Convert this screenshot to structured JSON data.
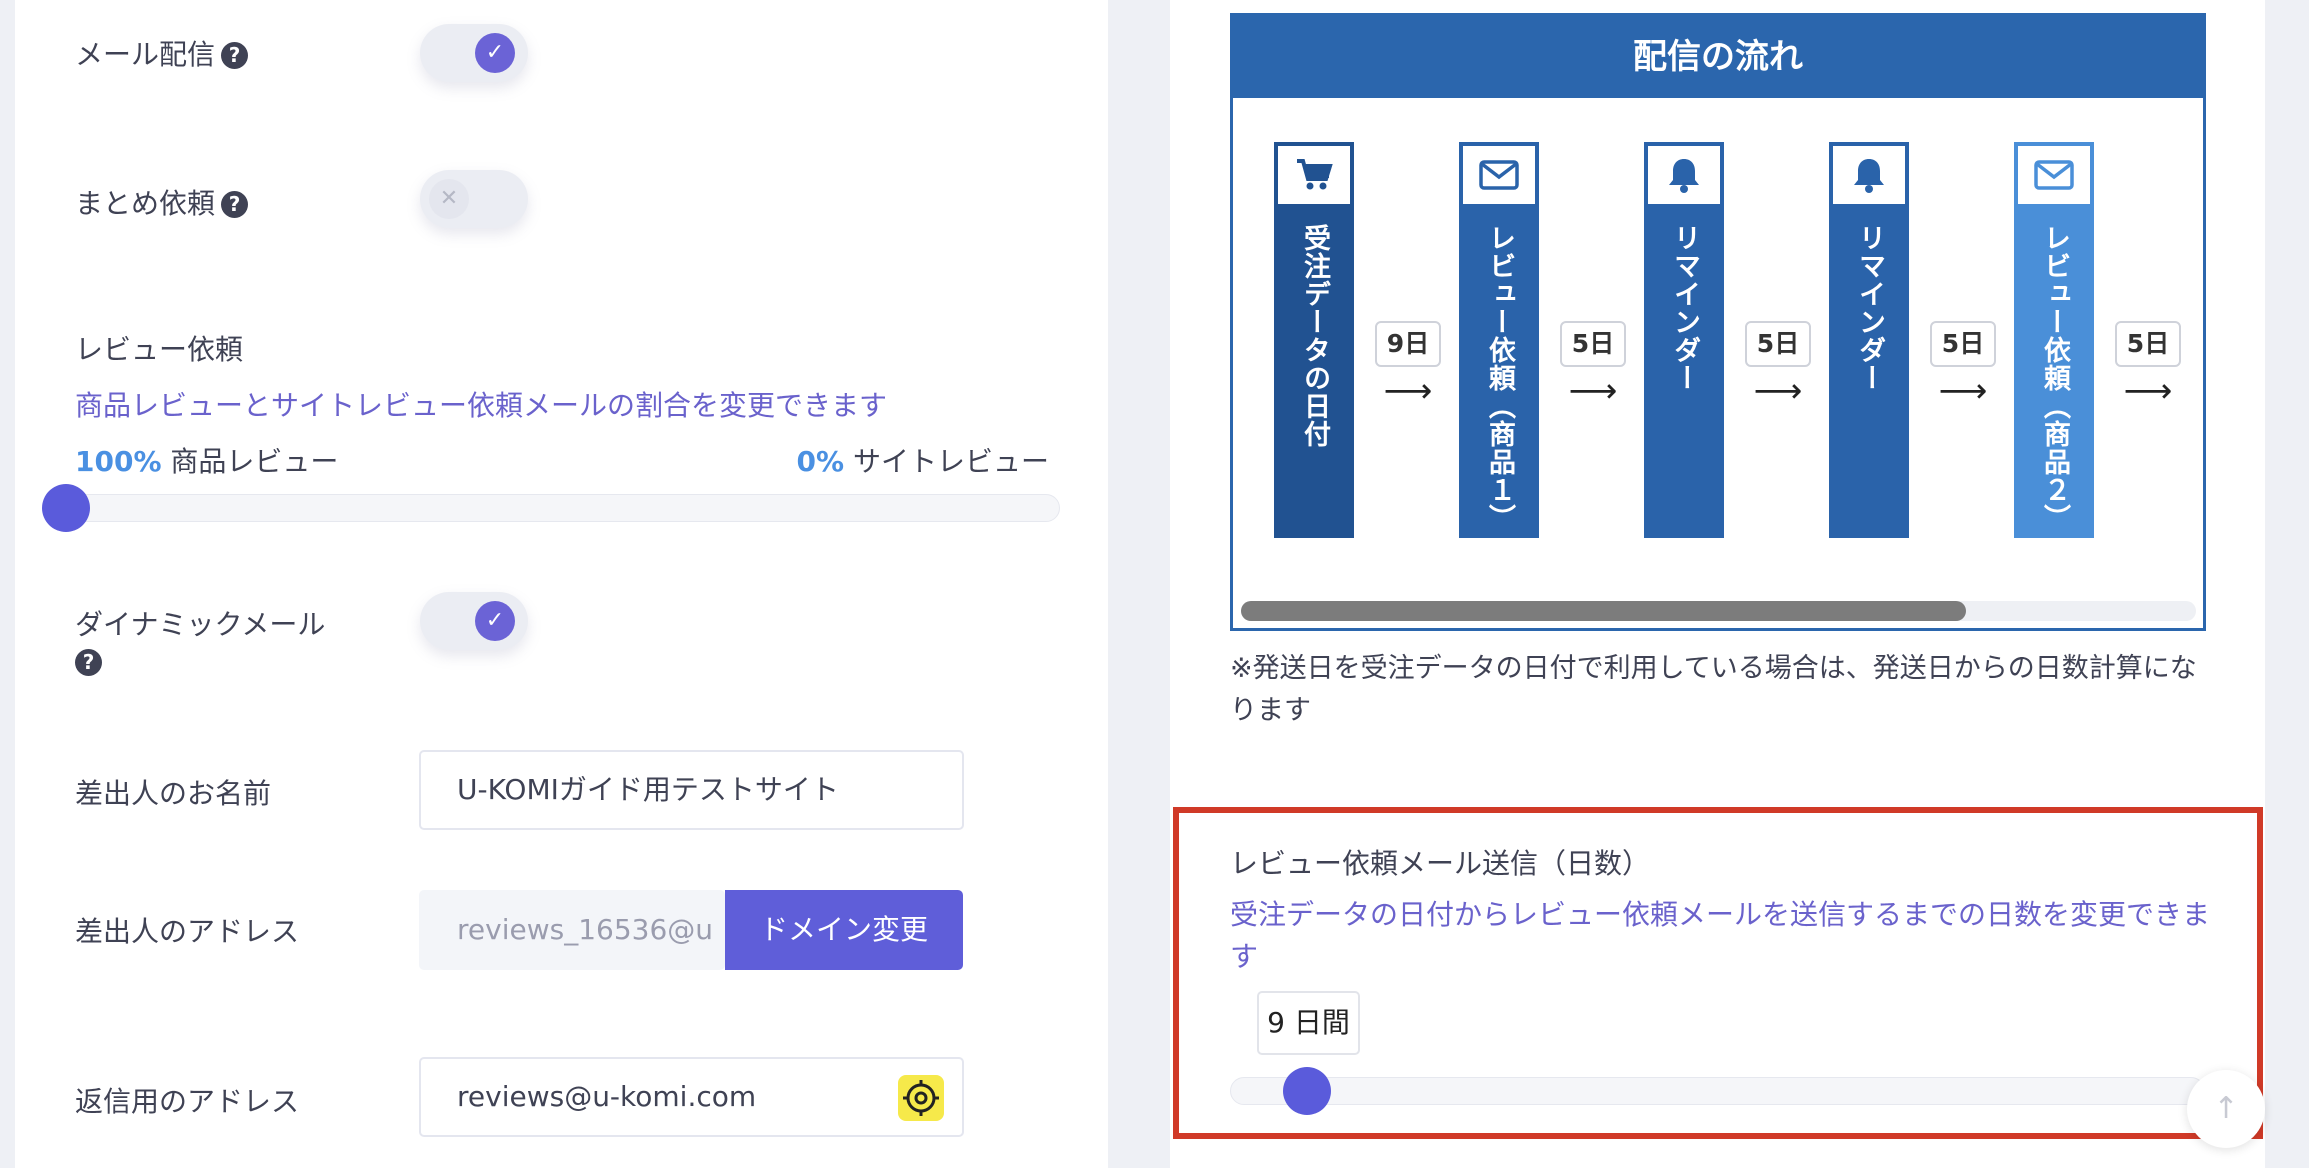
{
  "settings": {
    "mail_delivery": {
      "label": "メール配信",
      "enabled": true
    },
    "bundle_request": {
      "label": "まとめ依頼",
      "enabled": false
    },
    "review_request": {
      "label": "レビュー依頼",
      "description": "商品レビューとサイトレビュー依頼メールの割合を変更できます",
      "product_pct": "100%",
      "product_label": "商品レビュー",
      "site_pct": "0%",
      "site_label": "サイトレビュー",
      "product_ratio": 1.0
    },
    "dynamic_mail": {
      "label": "ダイナミックメール",
      "enabled": true
    },
    "sender_name": {
      "label": "差出人のお名前",
      "value": "U-KOMIガイド用テストサイト"
    },
    "sender_address": {
      "label": "差出人のアドレス",
      "value": "reviews_16536@u",
      "button": "ドメイン変更"
    },
    "reply_address": {
      "label": "返信用のアドレス",
      "value": "reviews@u-komi.com"
    }
  },
  "flow": {
    "title": "配信の流れ",
    "steps": [
      {
        "label": "受注データの日付",
        "icon": "cart-icon",
        "color": "#215291"
      },
      {
        "label": "レビュー依頼（商品１）",
        "icon": "mail-icon",
        "color": "#2a63aa"
      },
      {
        "label": "リマインダー",
        "icon": "bell-icon",
        "color": "#2a63aa"
      },
      {
        "label": "リマインダー",
        "icon": "bell-icon",
        "color": "#2a63aa"
      },
      {
        "label": "レビュー依頼（商品２）",
        "icon": "mail-icon",
        "color": "#4a8fd8"
      }
    ],
    "intervals": [
      "9日",
      "5日",
      "5日",
      "5日",
      "5日"
    ],
    "arrow": "⟶",
    "note": "※発送日を受注データの日付で利用している場合は、発送日からの日数計算になります"
  },
  "days_setting": {
    "label": "レビュー依頼メール送信（日数）",
    "description": "受注データの日付からレビュー依頼メールを送信するまでの日数を変更できます",
    "value_label": "9 日間"
  },
  "colors": {
    "accent": "#5f5ed9",
    "highlight_border": "#d03a28",
    "flow_blue": "#2b66ad"
  }
}
